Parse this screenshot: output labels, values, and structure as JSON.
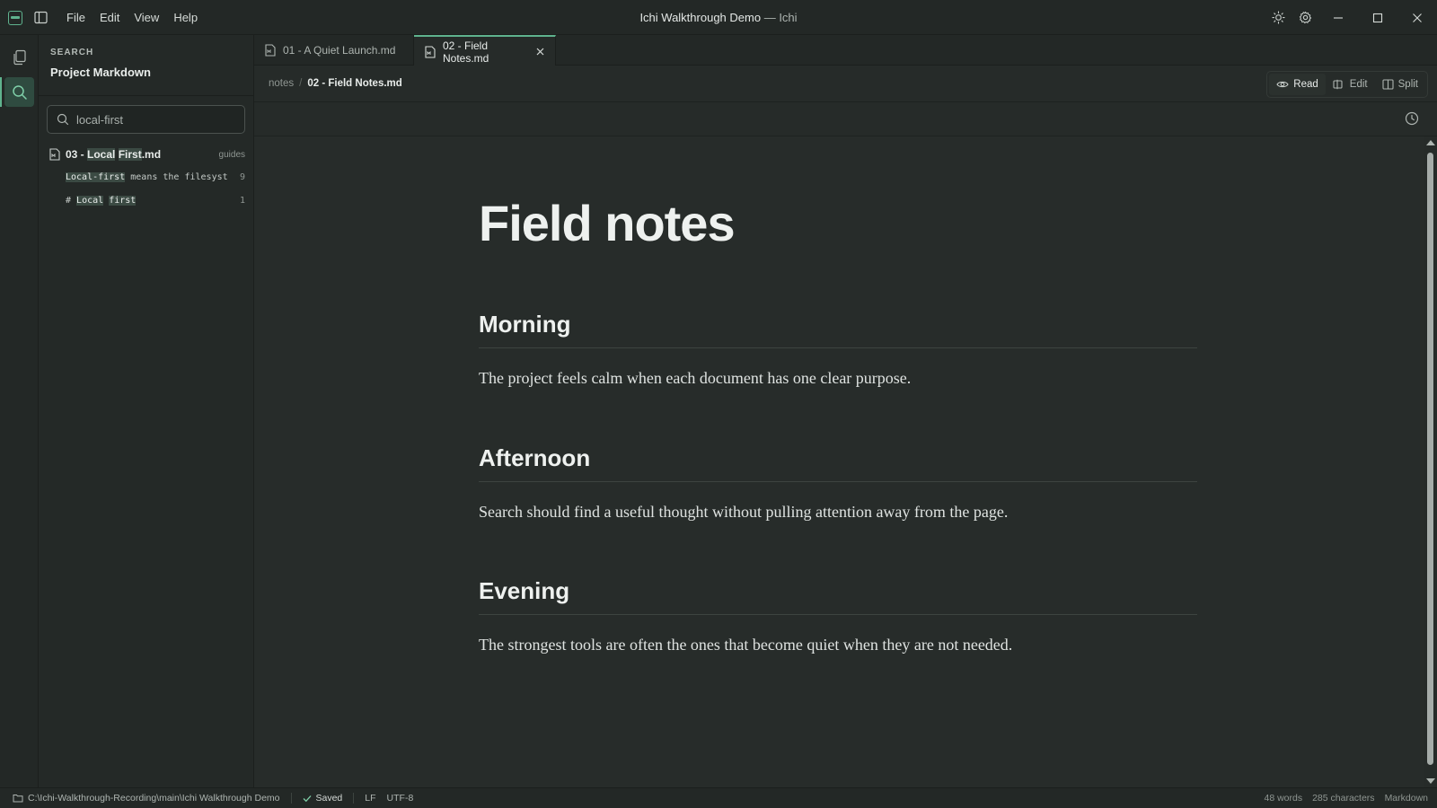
{
  "titlebar": {
    "menu": [
      "File",
      "Edit",
      "View",
      "Help"
    ],
    "window_title": "Ichi Walkthrough Demo",
    "window_title_sep": " — ",
    "app_name": "Ichi"
  },
  "panel": {
    "kicker": "SEARCH",
    "title": "Project Markdown",
    "search_value": "local-first",
    "result": {
      "file_prefix": "03 - ",
      "file_match1": "Local",
      "file_between": " ",
      "file_match2": "First",
      "file_suffix": ".md",
      "folder": "guides",
      "lines": [
        {
          "match": "Local-first",
          "rest": " means the filesyst…",
          "line": "9"
        },
        {
          "prefix": "# ",
          "match1": "Local",
          "between": " ",
          "match2": "first",
          "line": "1"
        }
      ]
    }
  },
  "tabs": [
    {
      "label": "01 - A Quiet Launch.md",
      "active": false
    },
    {
      "label": "02 - Field Notes.md",
      "active": true
    }
  ],
  "breadcrumb": {
    "folder": "notes",
    "separator": "/",
    "file": "02 - Field Notes.md"
  },
  "modes": {
    "read": "Read",
    "edit": "Edit",
    "split": "Split"
  },
  "document": {
    "title": "Field notes",
    "sections": [
      {
        "heading": "Morning",
        "text": "The project feels calm when each document has one clear purpose."
      },
      {
        "heading": "Afternoon",
        "text": "Search should find a useful thought without pulling attention away from the page."
      },
      {
        "heading": "Evening",
        "text": "The strongest tools are often the ones that become quiet when they are not needed."
      }
    ]
  },
  "status": {
    "path": "C:\\Ichi-Walkthrough-Recording\\main\\Ichi Walkthrough Demo",
    "saved": "Saved",
    "eol": "LF",
    "encoding": "UTF-8",
    "words": "48 words",
    "chars": "285 characters",
    "language": "Markdown"
  },
  "colors": {
    "accent": "#5fb38e",
    "background": "#262b29",
    "highlight": "#3b4a43"
  }
}
